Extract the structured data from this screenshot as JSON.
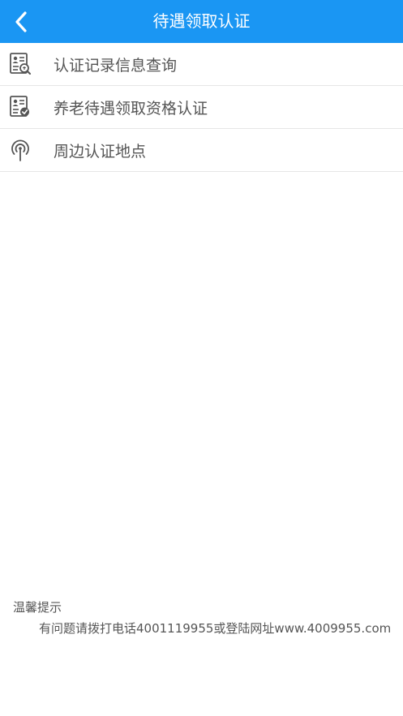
{
  "header": {
    "title": "待遇领取认证",
    "back_icon": "chevron-left-icon",
    "background_color": "#1a96f3"
  },
  "menu": {
    "items": [
      {
        "label": "认证记录信息查询",
        "icon": "id-card-search-icon"
      },
      {
        "label": "养老待遇领取资格认证",
        "icon": "id-card-check-icon"
      },
      {
        "label": "周边认证地点",
        "icon": "signal-location-icon"
      }
    ]
  },
  "tips": {
    "title": "温馨提示",
    "body": "有问题请拨打电话4001119955或登陆网址www.4009955.com"
  }
}
